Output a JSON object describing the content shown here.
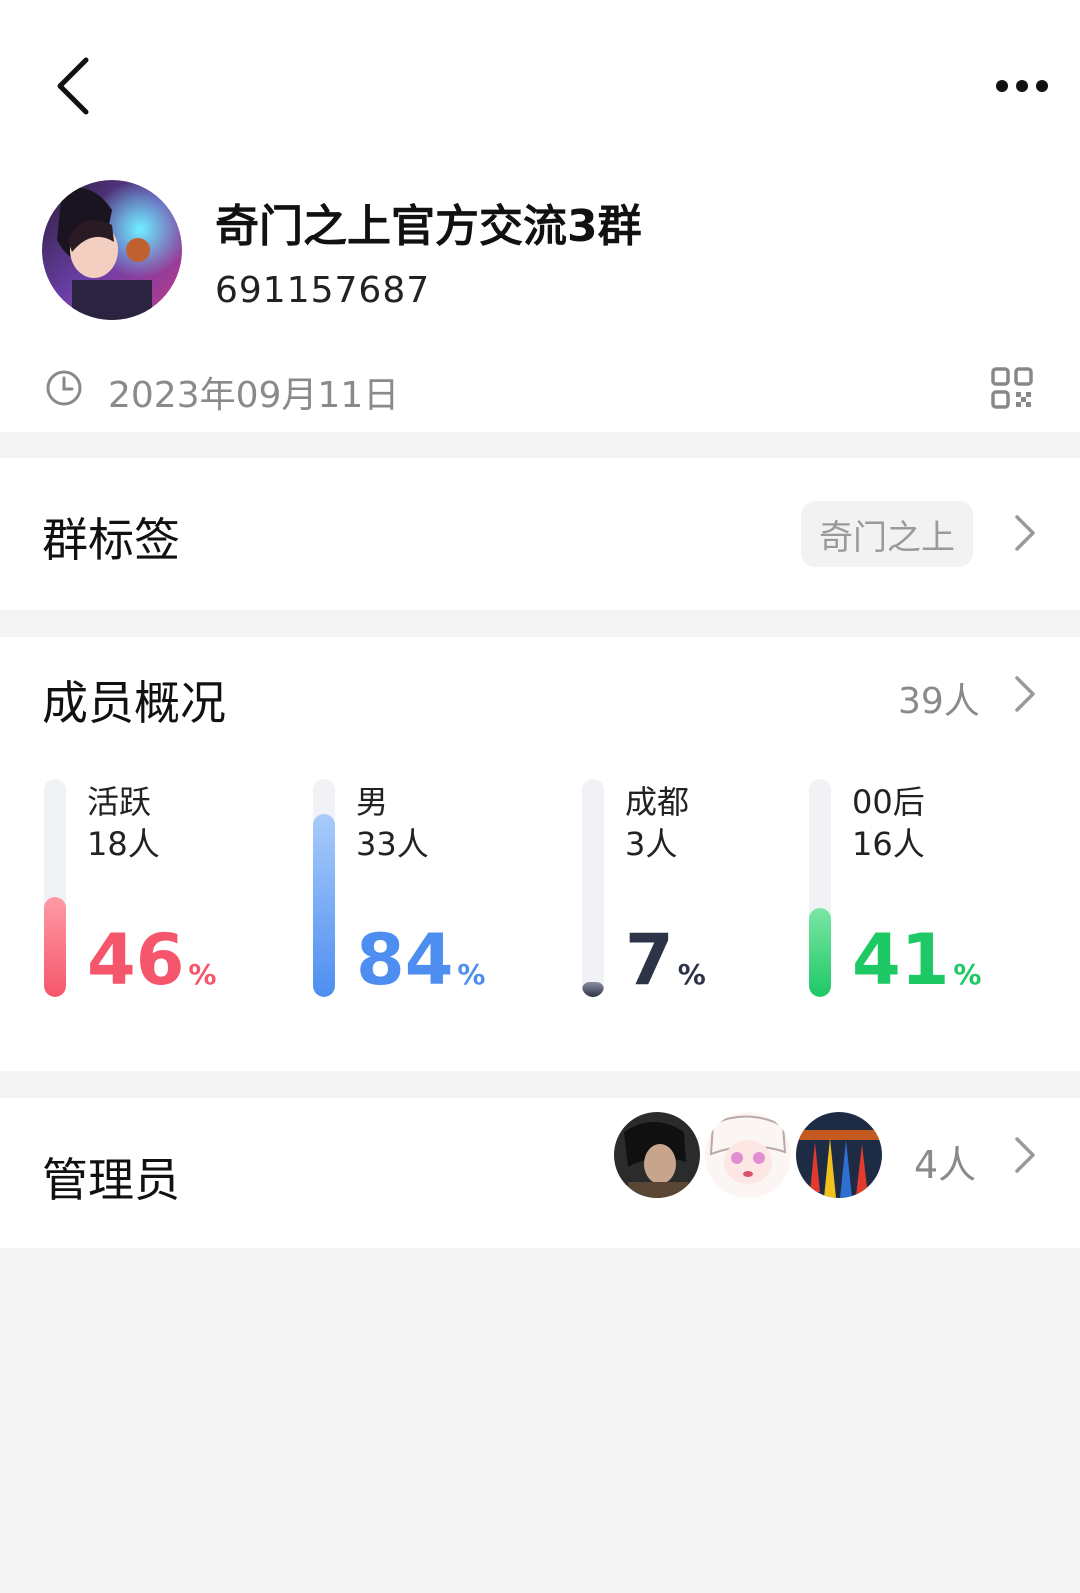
{
  "header": {
    "back_icon": "back-arrow-icon",
    "more_icon": "more-dots-icon"
  },
  "group": {
    "name": "奇门之上官方交流3群",
    "id": "691157687",
    "created_date": "2023年09月11日"
  },
  "tags_section": {
    "title": "群标签",
    "tag": "奇门之上"
  },
  "members_section": {
    "title": "成员概况",
    "total": "39人",
    "stats": [
      {
        "label": "活跃",
        "count": "18人",
        "percent": "46",
        "fraction": 0.46,
        "color": "#f5566b",
        "fill_light": "#ff9aa6"
      },
      {
        "label": "男",
        "count": "33人",
        "percent": "84",
        "fraction": 0.84,
        "color": "#4d8ef0",
        "fill_light": "#a9ccfb"
      },
      {
        "label": "成都",
        "count": "3人",
        "percent": "7",
        "fraction": 0.07,
        "color": "#2e3447",
        "fill_light": "#8a90a2"
      },
      {
        "label": "00后",
        "count": "16人",
        "percent": "41",
        "fraction": 0.41,
        "color": "#1ec865",
        "fill_light": "#7be6a5"
      }
    ],
    "percent_sign": "%"
  },
  "admins_section": {
    "title": "管理员",
    "count": "4人"
  },
  "colors": {
    "accent_red": "#f5566b",
    "accent_blue": "#4d8ef0",
    "accent_green": "#1ec865",
    "muted_text": "#8a8a8a"
  }
}
